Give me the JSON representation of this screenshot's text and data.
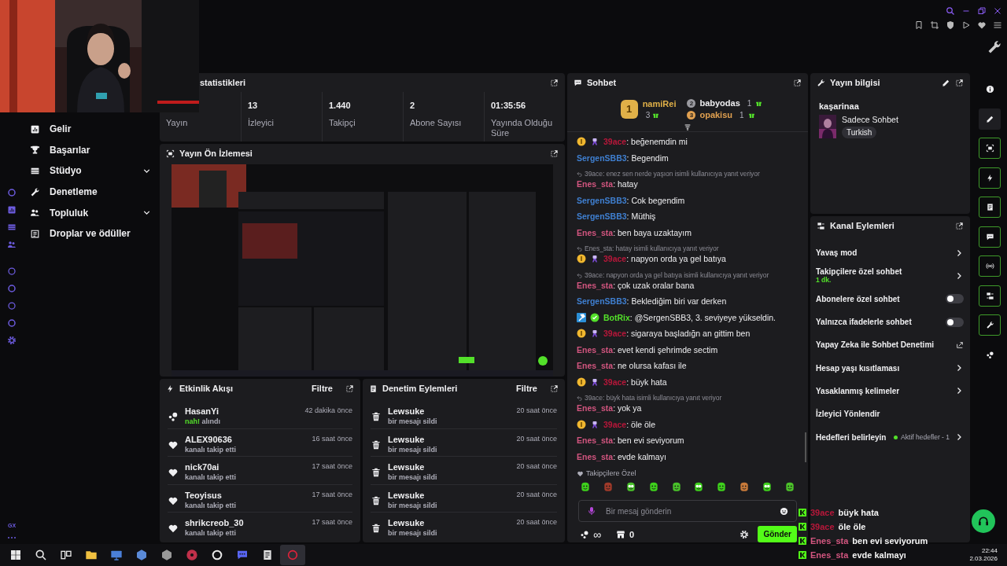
{
  "sidebar": {
    "items": [
      {
        "kind": "link",
        "label": "Gelir"
      },
      {
        "kind": "link",
        "label": "Başarılar"
      },
      {
        "kind": "group",
        "label": "Stüdyo"
      },
      {
        "kind": "link",
        "label": "Denetleme"
      },
      {
        "kind": "group",
        "label": "Topluluk"
      },
      {
        "kind": "link",
        "label": "Droplar ve ödüller"
      }
    ],
    "rail_label": "GX"
  },
  "stats_panel": {
    "title": "statistikleri",
    "stats": [
      {
        "label": "Yayın"
      },
      {
        "value": "13",
        "label": "İzleyici"
      },
      {
        "value": "1.440",
        "label": "Takipçi"
      },
      {
        "value": "2",
        "label": "Abone Sayısı"
      },
      {
        "value": "01:35:56",
        "label": "Yayında Olduğu Süre"
      }
    ]
  },
  "preview_panel": {
    "title": "Yayın Ön İzlemesi"
  },
  "activity_panel": {
    "title": "Etkinlik Akışı",
    "filter": "Filtre",
    "items": [
      {
        "kind": "points",
        "user": "HasanYi",
        "reward": "nah!",
        "action": "alındı",
        "time": "42 dakika önce"
      },
      {
        "kind": "follow",
        "user": "ALEX90636",
        "action": "kanalı takip etti",
        "time": "16 saat önce"
      },
      {
        "kind": "follow",
        "user": "nick70ai",
        "action": "kanalı takip etti",
        "time": "17 saat önce"
      },
      {
        "kind": "follow",
        "user": "Teoyisus",
        "action": "kanalı takip etti",
        "time": "17 saat önce"
      },
      {
        "kind": "follow",
        "user": "shrikcreob_30",
        "action": "kanalı takip etti",
        "time": "17 saat önce"
      }
    ]
  },
  "mod_panel": {
    "title": "Denetim Eylemleri",
    "filter": "Filtre",
    "items": [
      {
        "user": "Lewsuke",
        "action": "bir mesajı sildi",
        "time": "20 saat önce"
      },
      {
        "user": "Lewsuke",
        "action": "bir mesajı sildi",
        "time": "20 saat önce"
      },
      {
        "user": "Lewsuke",
        "action": "bir mesajı sildi",
        "time": "20 saat önce"
      },
      {
        "user": "Lewsuke",
        "action": "bir mesajı sildi",
        "time": "20 saat önce"
      },
      {
        "user": "Lewsuke",
        "action": "bir mesajı sildi",
        "time": "20 saat önce"
      }
    ]
  },
  "chat": {
    "title": "Sohbet",
    "leaderboard": [
      {
        "rank": "1",
        "user": "namiRei",
        "gifts": "3",
        "color": "#e0b048"
      },
      {
        "rank": "2",
        "user": "babyodas",
        "gifts": "1",
        "color": "#efeff1"
      },
      {
        "rank": "3",
        "user": "opakisu",
        "gifts": "1",
        "color": "#e0a050"
      }
    ],
    "messages": [
      {
        "badges": [
          {
            "kind": "gifter"
          },
          {
            "kind": "bot"
          }
        ],
        "user": "39ace",
        "color": "#b8173a",
        "text": ": beğenemdin mi"
      },
      {
        "user": "SergenSBB3",
        "color": "#3f7fd0",
        "text": ": Begendim"
      },
      {
        "reply_to": "39ace: enez sen nerde yaşıon isimli kullanıcıya yanıt veriyor",
        "user": "Enes_sta",
        "color": "#d2557f",
        "text": ": hatay"
      },
      {
        "user": "SergenSBB3",
        "color": "#3f7fd0",
        "text": ": Cok begendim"
      },
      {
        "user": "SergenSBB3",
        "color": "#3f7fd0",
        "text": ": Müthiş"
      },
      {
        "user": "Enes_sta",
        "color": "#d2557f",
        "text": ": ben baya uzaktayım"
      },
      {
        "reply_to": "Enes_sta: hatay isimli kullanıcıya yanıt veriyor",
        "badges": [
          {
            "kind": "gifter"
          },
          {
            "kind": "bot"
          }
        ],
        "user": "39ace",
        "color": "#b8173a",
        "text": ": napyon orda ya gel batıya"
      },
      {
        "reply_to": "39ace: napyon orda ya gel batıya isimli kullanıcıya yanıt veriyor",
        "user": "Enes_sta",
        "color": "#d2557f",
        "text": ": çok uzak oralar bana"
      },
      {
        "user": "SergenSBB3",
        "color": "#3f7fd0",
        "text": ": Beklediğim biri var derken"
      },
      {
        "badges": [
          {
            "kind": "mod"
          },
          {
            "kind": "verified"
          }
        ],
        "user": "BotRix",
        "color": "#53e02a",
        "text": ": @SergenSBB3, 3. seviyeye yükseldin."
      },
      {
        "badges": [
          {
            "kind": "gifter"
          },
          {
            "kind": "bot"
          }
        ],
        "user": "39ace",
        "color": "#b8173a",
        "text": ": sigaraya başladığn an gittim ben"
      },
      {
        "user": "Enes_sta",
        "color": "#d2557f",
        "text": ": evet kendi şehrimde sectim"
      },
      {
        "user": "Enes_sta",
        "color": "#d2557f",
        "text": ": ne olursa kafası ile"
      },
      {
        "badges": [
          {
            "kind": "gifter"
          },
          {
            "kind": "bot"
          }
        ],
        "user": "39ace",
        "color": "#b8173a",
        "text": ": büyk hata"
      },
      {
        "reply_to": "39ace: büyk hata isimli kullanıcıya yanıt veriyor",
        "user": "Enes_sta",
        "color": "#d2557f",
        "text": ": yok ya"
      },
      {
        "badges": [
          {
            "kind": "gifter"
          },
          {
            "kind": "bot"
          }
        ],
        "user": "39ace",
        "color": "#b8173a",
        "text": ": öle öle"
      },
      {
        "user": "Enes_sta",
        "color": "#d2557f",
        "text": ": ben evi seviyorum"
      },
      {
        "user": "Enes_sta",
        "color": "#d2557f",
        "text": ": evde kalmayı"
      }
    ],
    "emote_set": "Takipçilere Özel",
    "input": {
      "placeholder": "Bir mesaj gönderin"
    },
    "points": "∞",
    "store_count": "0",
    "send": "Gönder"
  },
  "stream_info": {
    "title": "Yayın bilgisi",
    "channel": "kaşarinaa",
    "stream_title": "Sadece Sohbet",
    "tag": "Turkish"
  },
  "channel_actions": {
    "title": "Kanal Eylemleri",
    "items": [
      {
        "kind": "chevron",
        "label": "Yavaş mod"
      },
      {
        "kind": "chevron",
        "label": "Takipçilere özel sohbet",
        "detail": "1 dk."
      },
      {
        "kind": "toggle",
        "label": "Abonelere özel sohbet",
        "on": false
      },
      {
        "kind": "toggle",
        "label": "Yalnızca ifadelerle sohbet",
        "on": false
      },
      {
        "kind": "external",
        "label": "Yapay Zeka ile Sohbet Denetimi"
      },
      {
        "kind": "chevron",
        "label": "Hesap yaşı kısıtlaması"
      },
      {
        "kind": "chevron",
        "label": "Yasaklanmış kelimeler"
      },
      {
        "kind": "plain",
        "label": "İzleyici Yönlendir"
      },
      {
        "kind": "chevron",
        "label": "Hedefleri belirleyin",
        "status": "Aktif hedefler - 1"
      }
    ]
  },
  "right_rail": [
    {
      "active": false
    },
    {
      "active": false
    },
    {
      "active": true
    },
    {
      "active": true
    },
    {
      "active": true
    },
    {
      "active": true
    },
    {
      "active": true
    },
    {
      "active": true
    },
    {
      "active": true
    },
    {
      "active": false
    }
  ],
  "overlay_chat": [
    {
      "user": "39ace",
      "color": "#b8173a",
      "text": "büyk hata"
    },
    {
      "user": "39ace",
      "color": "#b8173a",
      "text": "öle öle"
    },
    {
      "user": "Enes_sta",
      "color": "#d2557f",
      "text": "ben evi seviyorum"
    },
    {
      "user": "Enes_sta",
      "color": "#d2557f",
      "text": "evde kalmayı"
    }
  ],
  "taskbar": {
    "apps": [
      {
        "active": false
      },
      {
        "active": false
      },
      {
        "active": false
      },
      {
        "active": false
      },
      {
        "active": false
      },
      {
        "active": false
      },
      {
        "active": false
      },
      {
        "active": false
      },
      {
        "active": false
      },
      {
        "active": false
      },
      {
        "active": false
      },
      {
        "active": true
      }
    ],
    "time": "22:44",
    "date": "2.03.2026"
  }
}
